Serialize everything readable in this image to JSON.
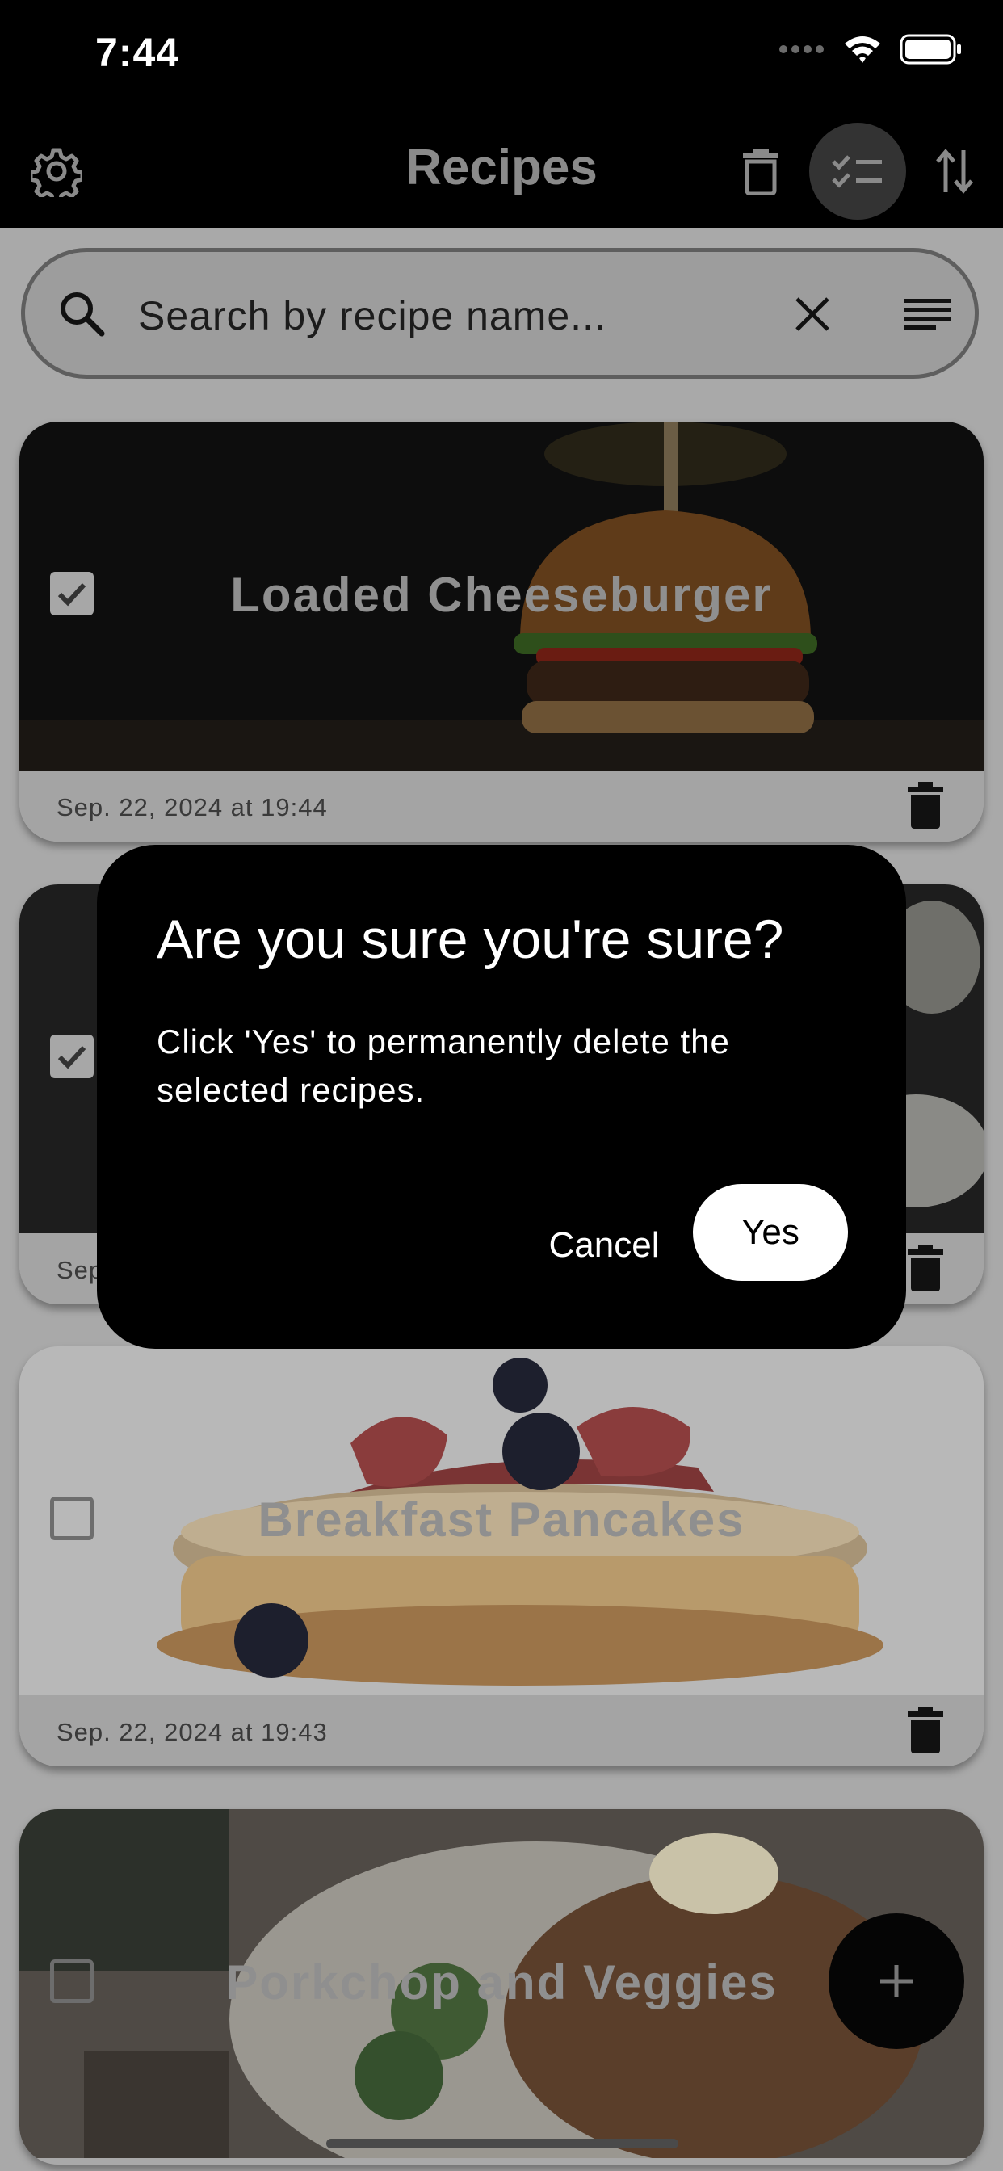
{
  "status_bar": {
    "time": "7:44"
  },
  "app_bar": {
    "title": "Recipes"
  },
  "search": {
    "placeholder": "Search by recipe name..."
  },
  "recipes": [
    {
      "title": "Loaded Cheeseburger",
      "date": "Sep. 22, 2024 at 19:44",
      "checked": true
    },
    {
      "title": "",
      "date": "Sep",
      "checked": true
    },
    {
      "title": "Breakfast Pancakes",
      "date": "Sep. 22, 2024 at 19:43",
      "checked": false
    },
    {
      "title": "Porkchop and Veggies",
      "date": "",
      "checked": false
    }
  ],
  "dialog": {
    "title": "Are you sure you're sure?",
    "body": "Click 'Yes' to permanently delete the selected recipes.",
    "cancel_label": "Cancel",
    "confirm_label": "Yes"
  },
  "icons": {
    "settings": "gear-icon",
    "delete_all": "trash-icon",
    "select_mode": "checklist-icon",
    "sort": "sort-arrows-icon",
    "search": "search-icon",
    "clear": "close-icon",
    "filter": "filter-list-icon",
    "add": "plus-icon"
  },
  "colors": {
    "app_bar": "#000000",
    "scrim": "#a9a9a9",
    "dialog": "#000000",
    "confirm_button": "#ffffff"
  }
}
